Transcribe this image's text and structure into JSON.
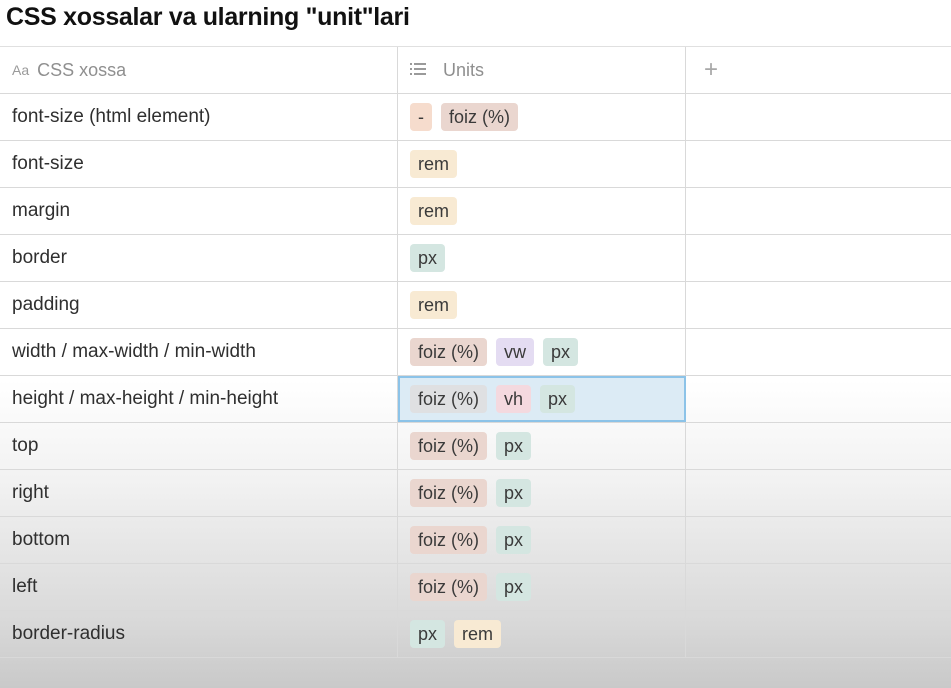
{
  "title": "CSS xossalar va ularning \"unit\"lari",
  "header": {
    "col1_icon": "Aa",
    "col1_label": "CSS xossa",
    "col2_icon": "list-icon",
    "col2_label": "Units",
    "add_column": "+"
  },
  "rows": [
    {
      "property": "font-size (html element)",
      "tags": [
        {
          "label": "-",
          "color": "#f6dccd"
        },
        {
          "label": "foiz (%)",
          "color": "#ead6cf"
        }
      ]
    },
    {
      "property": "font-size",
      "tags": [
        {
          "label": "rem",
          "color": "#f8ead3"
        }
      ]
    },
    {
      "property": "margin",
      "tags": [
        {
          "label": "rem",
          "color": "#f8ead3"
        }
      ]
    },
    {
      "property": "border",
      "tags": [
        {
          "label": "px",
          "color": "#d4e6e1"
        }
      ]
    },
    {
      "property": "padding",
      "tags": [
        {
          "label": "rem",
          "color": "#f8ead3"
        }
      ]
    },
    {
      "property": "width / max-width / min-width",
      "tags": [
        {
          "label": "foiz (%)",
          "color": "#ead6cf"
        },
        {
          "label": "vw",
          "color": "#e4dcf2"
        },
        {
          "label": "px",
          "color": "#d4e6e1"
        }
      ]
    },
    {
      "property": "height / max-height / min-height",
      "tags": [
        {
          "label": "foiz (%)",
          "color": "#dfe0e2"
        },
        {
          "label": "vh",
          "color": "#f4d9df"
        },
        {
          "label": "px",
          "color": "#d4e6e1"
        }
      ]
    },
    {
      "property": "top",
      "tags": [
        {
          "label": "foiz (%)",
          "color": "#ead6cf"
        },
        {
          "label": "px",
          "color": "#d4e6e1"
        }
      ]
    },
    {
      "property": "right",
      "tags": [
        {
          "label": "foiz (%)",
          "color": "#ead6cf"
        },
        {
          "label": "px",
          "color": "#d4e6e1"
        }
      ]
    },
    {
      "property": "bottom",
      "tags": [
        {
          "label": "foiz (%)",
          "color": "#ead6cf"
        },
        {
          "label": "px",
          "color": "#d4e6e1"
        }
      ]
    },
    {
      "property": "left",
      "tags": [
        {
          "label": "foiz (%)",
          "color": "#ead6cf"
        },
        {
          "label": "px",
          "color": "#d4e6e1"
        }
      ]
    },
    {
      "property": "border-radius",
      "tags": [
        {
          "label": "px",
          "color": "#d4e6e1"
        },
        {
          "label": "rem",
          "color": "#f8ead3"
        }
      ]
    }
  ]
}
